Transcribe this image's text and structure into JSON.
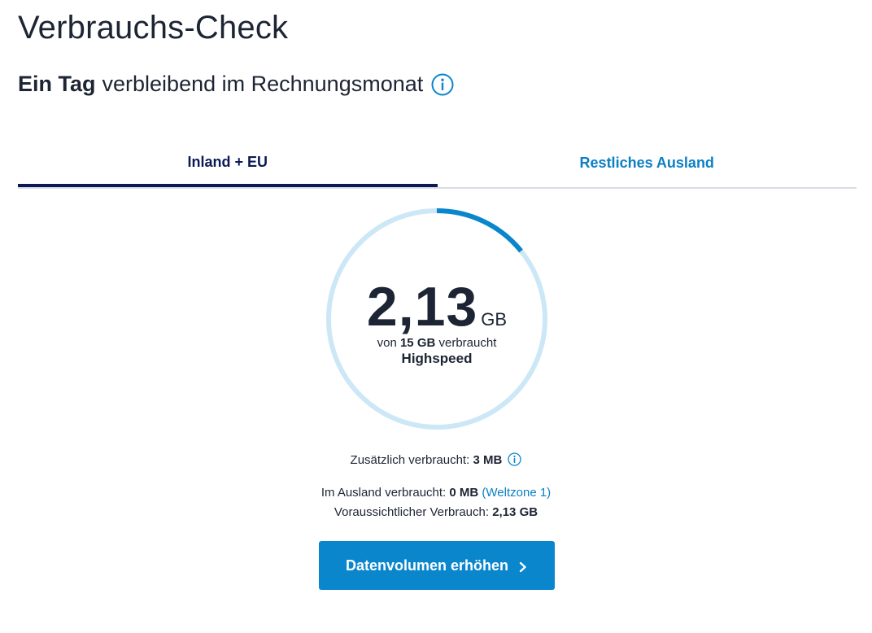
{
  "page": {
    "title": "Verbrauchs-Check",
    "remaining_bold": "Ein Tag",
    "remaining_rest": "verbleibend im Rechnungsmonat",
    "info_icon": "info-circle-icon"
  },
  "tabs": [
    {
      "label": "Inland + EU",
      "active": true
    },
    {
      "label": "Restliches Ausland",
      "active": false
    }
  ],
  "usage": {
    "used_value": "2,13",
    "used_unit": "GB",
    "of_prefix": "von",
    "total": "15 GB",
    "of_suffix": "verbraucht",
    "speed_label": "Highspeed",
    "used_fraction": 0.142,
    "colors": {
      "track": "#cce8f6",
      "progress": "#0a86cc"
    }
  },
  "extra": {
    "label": "Zusätzlich verbraucht:",
    "value": "3 MB",
    "info_icon": "info-circle-icon"
  },
  "abroad": {
    "label": "Im Ausland verbraucht:",
    "value": "0 MB",
    "zone": "(Weltzone 1)"
  },
  "forecast": {
    "label": "Voraussichtlicher Verbrauch:",
    "value": "2,13 GB"
  },
  "cta": {
    "label": "Datenvolumen erhöhen",
    "icon": "chevron-right-icon"
  },
  "colors": {
    "accent": "#0a86cc",
    "link": "#0a7fc4",
    "tab_active": "#0b1a54",
    "text": "#1d2433"
  }
}
